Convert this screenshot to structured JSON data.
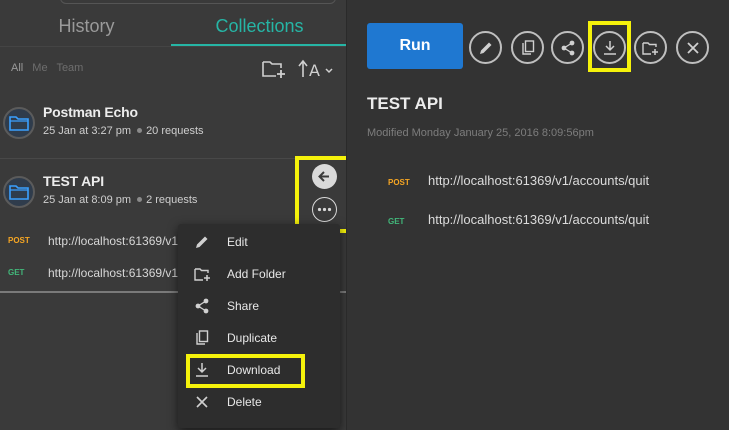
{
  "sidebar": {
    "tabs": [
      {
        "label": "History"
      },
      {
        "label": "Collections"
      }
    ],
    "filters": [
      "All",
      "Me",
      "Team"
    ],
    "collections": [
      {
        "name": "Postman Echo",
        "date": "25 Jan at 3:27 pm",
        "requests": "20 requests"
      },
      {
        "name": "TEST API",
        "date": "25 Jan at 8:09 pm",
        "requests": "2 requests"
      }
    ],
    "requests": [
      {
        "method": "POST",
        "url": "http://localhost:61369/v1/accounts/quit"
      },
      {
        "method": "GET",
        "url": "http://localhost:61369/v1/accounts/quit"
      }
    ]
  },
  "menu": {
    "items": [
      {
        "label": "Edit",
        "icon": "pencil-icon"
      },
      {
        "label": "Add Folder",
        "icon": "add-folder-icon"
      },
      {
        "label": "Share",
        "icon": "share-icon"
      },
      {
        "label": "Duplicate",
        "icon": "duplicate-icon"
      },
      {
        "label": "Download",
        "icon": "download-icon"
      },
      {
        "label": "Delete",
        "icon": "close-icon"
      }
    ]
  },
  "pane": {
    "run_label": "Run",
    "title": "TEST API",
    "modified": "Modified Monday January 25, 2016 8:09:56pm",
    "requests": [
      {
        "method": "POST",
        "url": "http://localhost:61369/v1/accounts/quit"
      },
      {
        "method": "GET",
        "url": "http://localhost:61369/v1/accounts/quit"
      }
    ],
    "actions": [
      "pencil-icon",
      "duplicate-icon",
      "share-icon",
      "download-icon",
      "add-folder-icon",
      "close-icon"
    ]
  },
  "colors": {
    "accent": "#26b5a5",
    "run_button": "#1f78d1",
    "highlight": "#f5f20b",
    "post": "#f6a623",
    "get": "#42b77a"
  }
}
